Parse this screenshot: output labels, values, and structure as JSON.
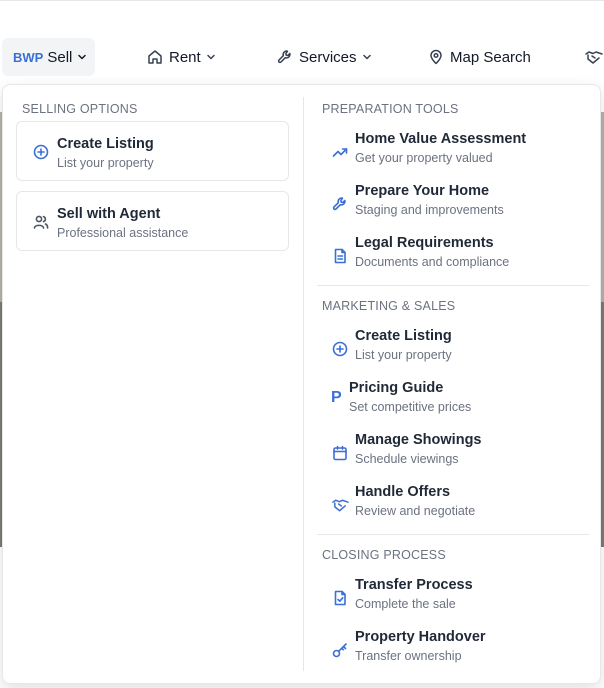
{
  "nav": {
    "brand": "BWP",
    "sell": "Sell",
    "rent": "Rent",
    "services": "Services",
    "map_search": "Map Search"
  },
  "selling_options": {
    "title": "SELLING OPTIONS",
    "items": [
      {
        "title": "Create Listing",
        "subtitle": "List your property",
        "icon": "plus-circle-icon"
      },
      {
        "title": "Sell with Agent",
        "subtitle": "Professional assistance",
        "icon": "users-icon"
      }
    ]
  },
  "preparation_tools": {
    "title": "PREPARATION TOOLS",
    "items": [
      {
        "title": "Home Value Assessment",
        "subtitle": "Get your property valued",
        "icon": "trending-up-icon"
      },
      {
        "title": "Prepare Your Home",
        "subtitle": "Staging and improvements",
        "icon": "wrench-icon"
      },
      {
        "title": "Legal Requirements",
        "subtitle": "Documents and compliance",
        "icon": "document-icon"
      }
    ]
  },
  "marketing_sales": {
    "title": "MARKETING & SALES",
    "items": [
      {
        "title": "Create Listing",
        "subtitle": "List your property",
        "icon": "plus-circle-icon"
      },
      {
        "title": "Pricing Guide",
        "subtitle": "Set competitive prices",
        "icon": "p-letter-icon",
        "icon_glyph": "P"
      },
      {
        "title": "Manage Showings",
        "subtitle": "Schedule viewings",
        "icon": "calendar-icon"
      },
      {
        "title": "Handle Offers",
        "subtitle": "Review and negotiate",
        "icon": "handshake-icon"
      }
    ]
  },
  "closing_process": {
    "title": "CLOSING PROCESS",
    "items": [
      {
        "title": "Transfer Process",
        "subtitle": "Complete the sale",
        "icon": "file-check-icon"
      },
      {
        "title": "Property Handover",
        "subtitle": "Transfer ownership",
        "icon": "key-icon"
      }
    ]
  },
  "colors": {
    "accent": "#3b6fd8",
    "text": "#1f2937",
    "muted": "#6b7280",
    "border": "#e5e7eb"
  }
}
